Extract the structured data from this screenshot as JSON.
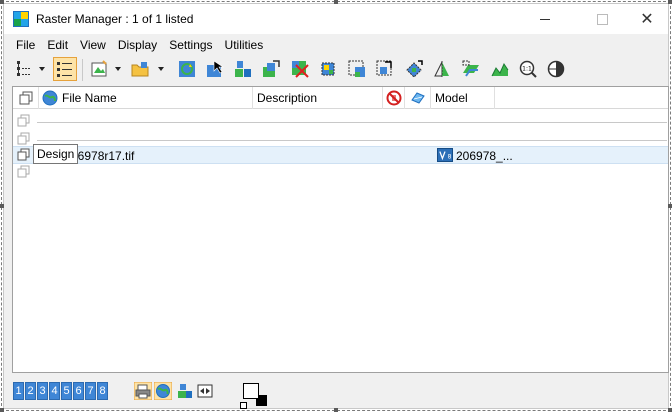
{
  "window": {
    "title": "Raster Manager : 1 of 1 listed",
    "minimize": "minimize",
    "maximize": "maximize",
    "close": "✕"
  },
  "menu": [
    "File",
    "Edit",
    "View",
    "Display",
    "Settings",
    "Utilities"
  ],
  "columns": {
    "file_name": "File Name",
    "description": "Description",
    "model": "Model"
  },
  "rows": {
    "tooltip": "Design",
    "file_name": "06978r17.tif",
    "model": "206978_..."
  },
  "status": {
    "views": [
      "1",
      "2",
      "3",
      "4",
      "5",
      "6",
      "7",
      "8"
    ]
  },
  "colors": {
    "selection_bg": "#e5f1fb",
    "pressed_bg": "#fde3a7",
    "view_button": "#3f86d6"
  }
}
